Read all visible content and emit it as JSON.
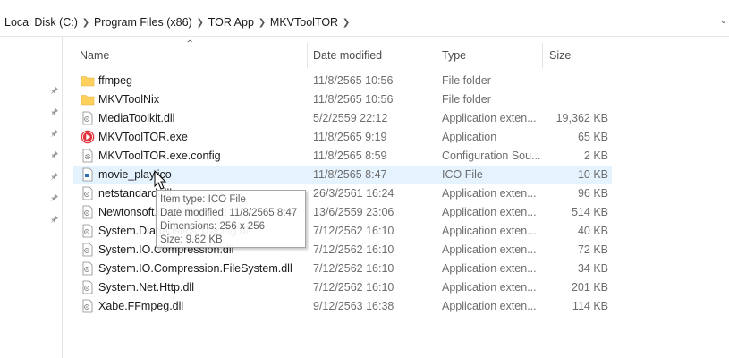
{
  "breadcrumb": {
    "items": [
      "Local Disk (C:)",
      "Program Files (x86)",
      "TOR App",
      "MKVToolTOR"
    ],
    "separator": ">",
    "dropdown_icon": "chevron-down-icon"
  },
  "columns": {
    "name": "Name",
    "date": "Date modified",
    "type": "Type",
    "size": "Size"
  },
  "files": [
    {
      "name": "ffmpeg",
      "date": "11/8/2565 10:56",
      "type": "File folder",
      "size": "",
      "icon": "folder-icon"
    },
    {
      "name": "MKVToolNix",
      "date": "11/8/2565 10:56",
      "type": "File folder",
      "size": "",
      "icon": "folder-icon"
    },
    {
      "name": "MediaToolkit.dll",
      "date": "5/2/2559 22:12",
      "type": "Application exten...",
      "size": "19,362 KB",
      "icon": "dll-file-icon"
    },
    {
      "name": "MKVToolTOR.exe",
      "date": "11/8/2565 9:19",
      "type": "Application",
      "size": "65 KB",
      "icon": "play-app-icon"
    },
    {
      "name": "MKVToolTOR.exe.config",
      "date": "11/8/2565 8:59",
      "type": "Configuration Sou...",
      "size": "2 KB",
      "icon": "config-file-icon"
    },
    {
      "name": "movie_play.ico",
      "date": "11/8/2565 8:47",
      "type": "ICO File",
      "size": "10 KB",
      "icon": "ico-file-icon"
    },
    {
      "name": "netstandard.dll",
      "date": "26/3/2561 16:24",
      "type": "Application exten...",
      "size": "96 KB",
      "icon": "dll-file-icon"
    },
    {
      "name": "Newtonsoft.Json.dll",
      "date": "13/6/2559 23:06",
      "type": "Application exten...",
      "size": "514 KB",
      "icon": "dll-file-icon"
    },
    {
      "name": "System.Diagnostics.Tracing.dll",
      "date": "7/12/2562 16:10",
      "type": "Application exten...",
      "size": "40 KB",
      "icon": "dll-file-icon"
    },
    {
      "name": "System.IO.Compression.dll",
      "date": "7/12/2562 16:10",
      "type": "Application exten...",
      "size": "72 KB",
      "icon": "dll-file-icon"
    },
    {
      "name": "System.IO.Compression.FileSystem.dll",
      "date": "7/12/2562 16:10",
      "type": "Application exten...",
      "size": "34 KB",
      "icon": "dll-file-icon"
    },
    {
      "name": "System.Net.Http.dll",
      "date": "7/12/2562 16:10",
      "type": "Application exten...",
      "size": "201 KB",
      "icon": "dll-file-icon"
    },
    {
      "name": "Xabe.FFmpeg.dll",
      "date": "9/12/2563 16:38",
      "type": "Application exten...",
      "size": "114 KB",
      "icon": "dll-file-icon"
    }
  ],
  "tooltip": {
    "line1": "Item type: ICO File",
    "line2": "Date modified: 11/8/2565 8:47",
    "line3": "Dimensions: 256 x 256",
    "line4": "Size: 9.82 KB"
  },
  "colors": {
    "selection": "#e5f3ff",
    "folder": "#ffd15c",
    "app_icon": "#e0323c",
    "muted_text": "#6d6d6d"
  }
}
